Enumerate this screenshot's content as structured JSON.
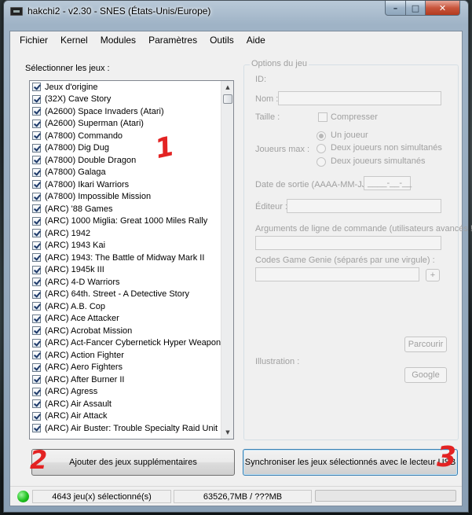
{
  "window": {
    "title": "hakchi2 - v2.30 - SNES (États-Unis/Europe)",
    "controls": {
      "minimize": "–",
      "maximize": "□",
      "close": "✕"
    }
  },
  "menu": [
    "Fichier",
    "Kernel",
    "Modules",
    "Paramètres",
    "Outils",
    "Aide"
  ],
  "games": {
    "label": "Sélectionner les jeux :",
    "items": [
      "Jeux d'origine",
      "(32X) Cave Story",
      "(A2600) Space Invaders (Atari)",
      "(A2600) Superman (Atari)",
      "(A7800) Commando",
      "(A7800) Dig Dug",
      "(A7800) Double Dragon",
      "(A7800) Galaga",
      "(A7800) Ikari Warriors",
      "(A7800) Impossible Mission",
      "(ARC) '88 Games",
      "(ARC) 1000 Miglia: Great 1000 Miles Rally",
      "(ARC) 1942",
      "(ARC) 1943 Kai",
      "(ARC) 1943: The Battle of Midway Mark II",
      "(ARC) 1945k III",
      "(ARC) 4-D Warriors",
      "(ARC) 64th. Street - A Detective Story",
      "(ARC) A.B. Cop",
      "(ARC) Ace Attacker",
      "(ARC) Acrobat Mission",
      "(ARC) Act-Fancer Cybernetick Hyper Weapon",
      "(ARC) Action Fighter",
      "(ARC) Aero Fighters",
      "(ARC) After Burner II",
      "(ARC) Agress",
      "(ARC) Air Assault",
      "(ARC) Air Attack",
      "(ARC) Air Buster: Trouble Specialty Raid Unit"
    ]
  },
  "options": {
    "legend": "Options du jeu",
    "id_label": "ID:",
    "name_label": "Nom :",
    "size_label": "Taille :",
    "compress_label": "Compresser",
    "players_label": "Joueurs max :",
    "player_options": [
      "Un joueur",
      "Deux joueurs non simultanés",
      "Deux joueurs simultanés"
    ],
    "release_label": "Date de sortie (AAAA-MM-JJ) :",
    "release_value": "____-__-__",
    "publisher_label": "Éditeur :",
    "args_label": "Arguments de ligne de commande (utilisateurs avancés !)",
    "genie_label": "Codes Game Genie (séparés par une virgule) :",
    "genie_add": "+",
    "browse_button": "Parcourir",
    "illustration_label": "Illustration :",
    "google_button": "Google"
  },
  "buttons": {
    "add_games": "Ajouter des jeux supplémentaires",
    "sync": "Synchroniser les jeux sélectionnés avec le lecteur USB"
  },
  "status": {
    "selected": "4643 jeu(x) sélectionné(s)",
    "size": "63526,7MB / ???MB",
    "progress": 0
  },
  "annotations": [
    "1",
    "2",
    "3"
  ]
}
